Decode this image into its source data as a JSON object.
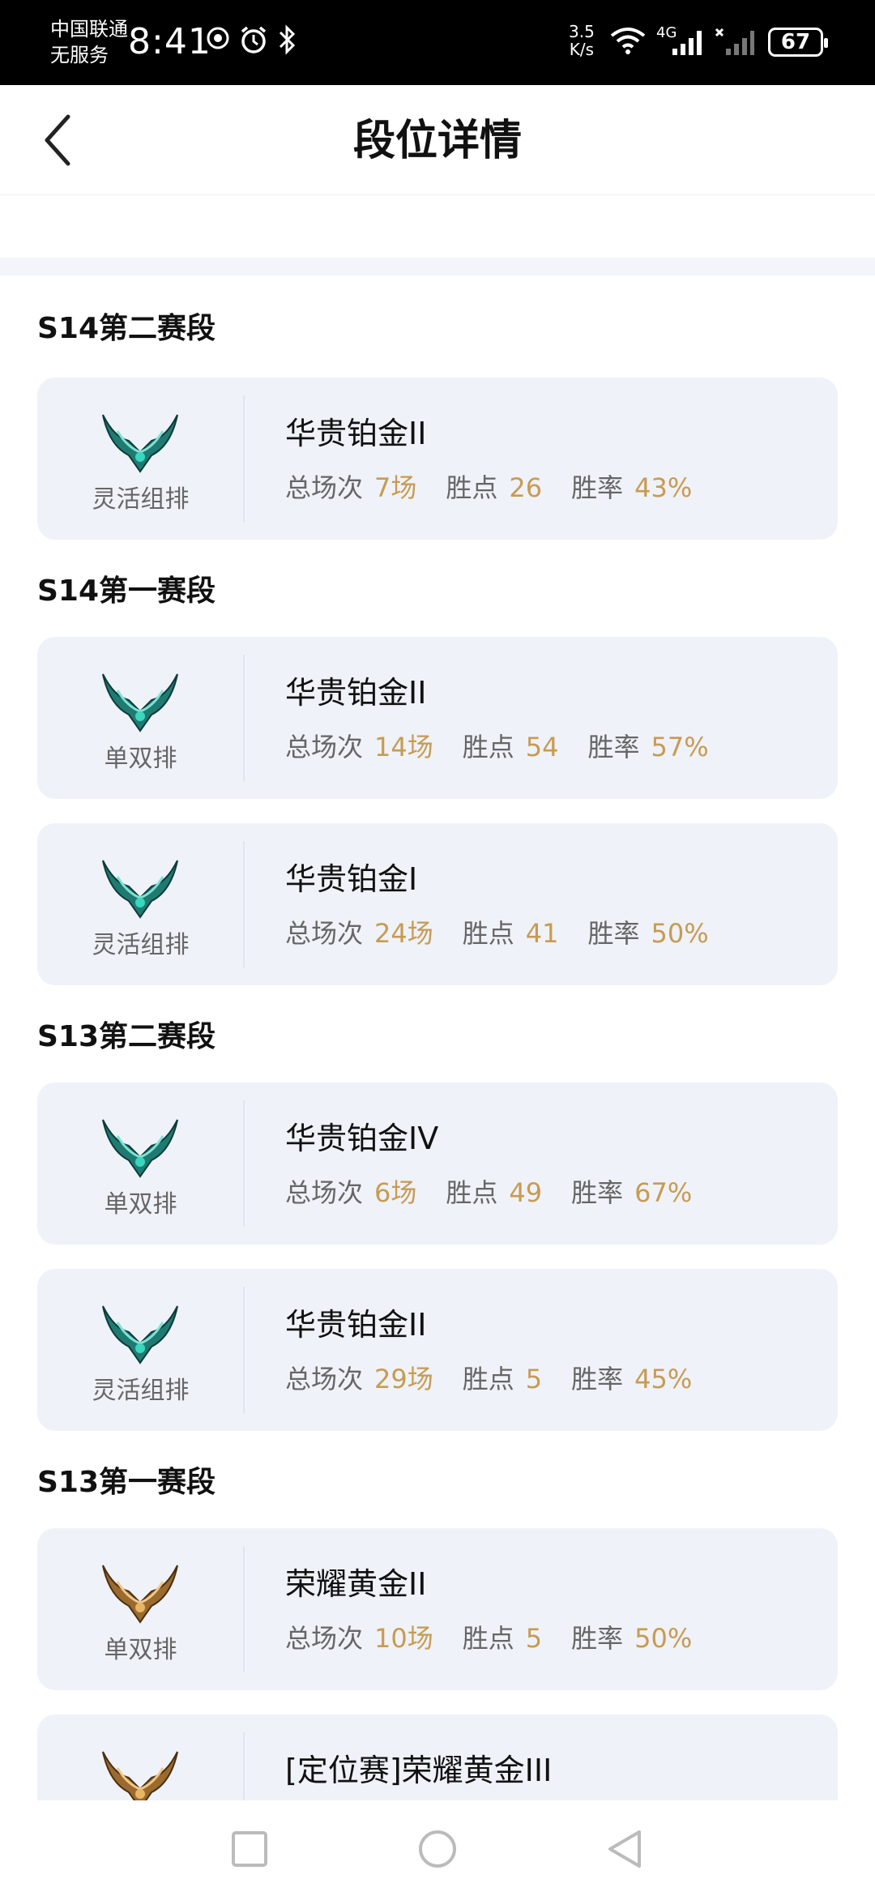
{
  "status_bar": {
    "carrier_line1": "中国联通",
    "carrier_line2": "无服务",
    "time": "8:41",
    "speed_value": "3.5",
    "speed_unit": "K/s",
    "network": "4G",
    "battery": "67",
    "icons": [
      "vpn-icon",
      "alarm-icon",
      "bluetooth-icon",
      "wifi-icon",
      "signal-icon",
      "no-signal-icon",
      "battery-icon"
    ]
  },
  "header": {
    "title": "段位详情",
    "back_icon": "chevron-left-icon"
  },
  "labels": {
    "total_games": "总场次",
    "points": "胜点",
    "win_rate": "胜率"
  },
  "colors": {
    "accent_gold": "#c79b53",
    "card_bg": "#eff2f8",
    "platinum_badge": "#1f7a72",
    "gold_badge": "#9b6a2e"
  },
  "seasons": [
    {
      "title": "S14第二赛段",
      "entries": [
        {
          "queue": "灵活组排",
          "tier": "华贵铂金II",
          "badge": "platinum-badge-icon",
          "games": "7场",
          "points": "26",
          "win_rate": "43%"
        }
      ]
    },
    {
      "title": "S14第一赛段",
      "entries": [
        {
          "queue": "单双排",
          "tier": "华贵铂金II",
          "badge": "platinum-badge-icon",
          "games": "14场",
          "points": "54",
          "win_rate": "57%"
        },
        {
          "queue": "灵活组排",
          "tier": "华贵铂金I",
          "badge": "platinum-badge-icon",
          "games": "24场",
          "points": "41",
          "win_rate": "50%"
        }
      ]
    },
    {
      "title": "S13第二赛段",
      "entries": [
        {
          "queue": "单双排",
          "tier": "华贵铂金IV",
          "badge": "platinum-badge-icon",
          "games": "6场",
          "points": "49",
          "win_rate": "67%"
        },
        {
          "queue": "灵活组排",
          "tier": "华贵铂金II",
          "badge": "platinum-badge-icon",
          "games": "29场",
          "points": "5",
          "win_rate": "45%"
        }
      ]
    },
    {
      "title": "S13第一赛段",
      "entries": [
        {
          "queue": "单双排",
          "tier": "荣耀黄金II",
          "badge": "gold-badge-icon",
          "games": "10场",
          "points": "5",
          "win_rate": "50%"
        },
        {
          "queue": "",
          "tier": "[定位赛]荣耀黄金III",
          "badge": "gold-badge-icon",
          "games": "",
          "points": "",
          "win_rate": ""
        }
      ]
    }
  ],
  "nav_bar": {
    "icons": [
      "recent-apps-icon",
      "home-icon",
      "back-triangle-icon"
    ]
  }
}
